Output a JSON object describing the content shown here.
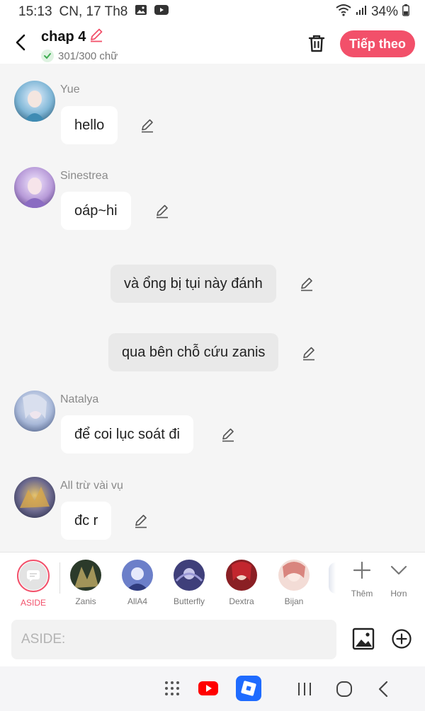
{
  "status_bar": {
    "time": "15:13",
    "date": "CN, 17 Th8",
    "battery": "34%",
    "notification_icons": [
      "gallery-icon",
      "youtube-icon"
    ]
  },
  "header": {
    "title": "chap 4",
    "word_count": "301/300 chữ",
    "next_button": "Tiếp theo"
  },
  "messages": [
    {
      "type": "character",
      "sender": "Yue",
      "text": "hello",
      "avatar_color": "#7fb6d6"
    },
    {
      "type": "character",
      "sender": "Sinestrea",
      "text": "oáp~hi",
      "avatar_color": "#b79ad8"
    },
    {
      "type": "aside",
      "text": "và ổng bị tụi này đánh"
    },
    {
      "type": "aside",
      "text": "qua bên chỗ cứu zanis"
    },
    {
      "type": "character",
      "sender": "Natalya",
      "text": "để coi lục soát đi",
      "avatar_color": "#a8b8d8"
    },
    {
      "type": "character",
      "sender": "All trừ vài vụ",
      "text": "đc r",
      "avatar_color": "#2d3552"
    }
  ],
  "characters": {
    "selected": "ASIDE",
    "items": [
      {
        "name": "Zanis",
        "color": "#2b3a2a"
      },
      {
        "name": "AllA4",
        "color": "#6c7fc9"
      },
      {
        "name": "Butterfly",
        "color": "#3f3f7a"
      },
      {
        "name": "Dextra",
        "color": "#8a1f24"
      },
      {
        "name": "Bijan",
        "color": "#d9857e"
      }
    ],
    "more_label": "Thêm",
    "expand_label": "Hơn"
  },
  "composer": {
    "placeholder": "ASIDE:"
  },
  "colors": {
    "accent": "#f2506a",
    "bubble": "#ffffff",
    "aside_bubble": "#e9e9e9",
    "background": "#f5f5f5"
  }
}
